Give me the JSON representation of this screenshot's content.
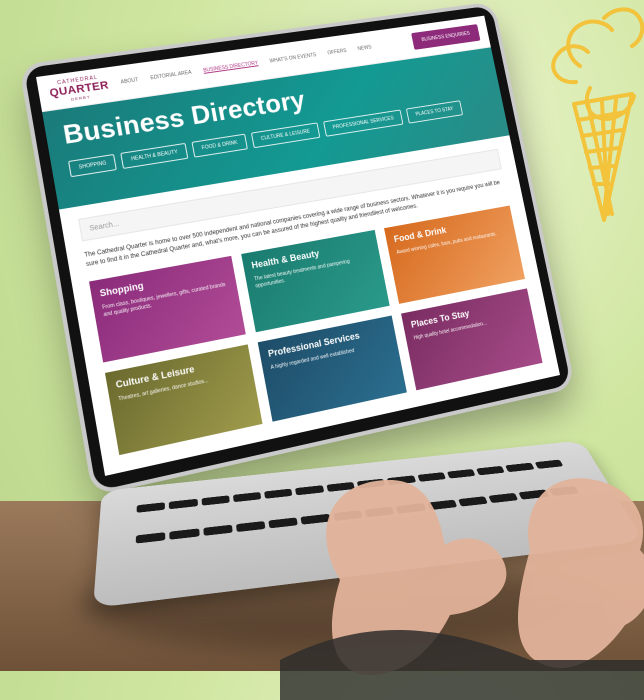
{
  "site": {
    "logo_top": "CATHEDRAL",
    "logo_main": "QUARTER",
    "logo_sub": "DERBY",
    "nav": [
      "ABOUT",
      "EDITORIAL AREA",
      "BUSINESS DIRECTORY",
      "WHAT'S ON EVENTS",
      "OFFERS",
      "NEWS"
    ],
    "nav_active_index": 2,
    "cta": "BUSINESS ENQUIRIES"
  },
  "hero": {
    "title": "Business Directory",
    "chips": [
      "SHOPPING",
      "HEALTH & BEAUTY",
      "FOOD & DRINK",
      "CULTURE & LEISURE",
      "PROFESSIONAL SERVICES",
      "PLACES TO STAY"
    ]
  },
  "search": {
    "placeholder": "Search..."
  },
  "intro": {
    "text": "The Cathedral Quarter is home to over 500 independent and national companies covering a wide range of business sectors. Whatever it is you require you will be sure to find it in the Cathedral Quarter and, what's more, you can be assured of the highest quality and friendliest of welcomes."
  },
  "cards": [
    {
      "title": "Shopping",
      "desc": "From class, boutiques, jewellers, gifts, curated brands and quality products."
    },
    {
      "title": "Health & Beauty",
      "desc": "The latest beauty treatments and pampering opportunities."
    },
    {
      "title": "Food & Drink",
      "desc": "Award winning cafes, bars, pubs and restaurants."
    },
    {
      "title": "Culture & Leisure",
      "desc": "Theatres, art galleries, dance studios..."
    },
    {
      "title": "Professional Services",
      "desc": "A highly regarded and well established"
    },
    {
      "title": "Places To Stay",
      "desc": "High quality hotel accommodation..."
    }
  ],
  "colors": {
    "background": "#cfe6a0",
    "accent_magenta": "#8d1f57",
    "hero_teal": "#139a93",
    "cone_yellow": "#f2c33b"
  }
}
